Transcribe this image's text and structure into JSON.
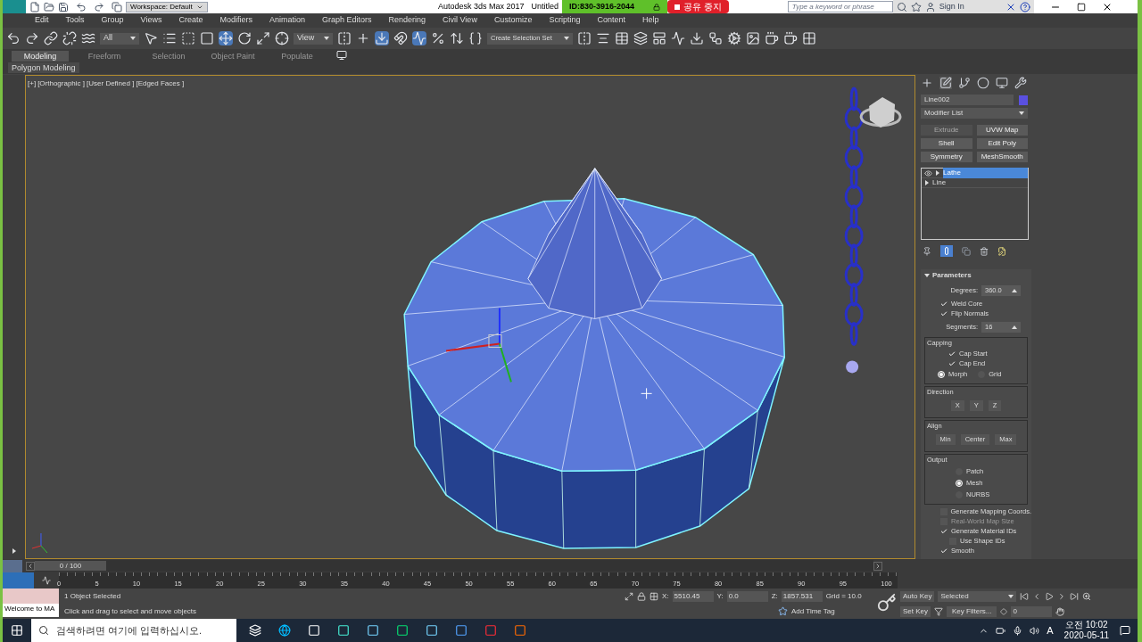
{
  "title_bar": {
    "workspace": "Workspace: Default",
    "app_title": "Autodesk 3ds Max 2017",
    "doc_title": "Untitled",
    "session_id": "ID:830-3916-2044",
    "stop_share": "공유 중지",
    "search": {
      "placeholder": "Type a keyword or phrase"
    },
    "sign_in": "Sign In"
  },
  "menu": [
    "Edit",
    "Tools",
    "Group",
    "Views",
    "Create",
    "Modifiers",
    "Animation",
    "Graph Editors",
    "Rendering",
    "Civil View",
    "Customize",
    "Scripting",
    "Content",
    "Help"
  ],
  "toolbar": {
    "selection_filter": "All",
    "reference_coord": "View",
    "named_selection": "Create Selection Set"
  },
  "ribbon_tabs": [
    {
      "label": "Modeling",
      "selected": true
    },
    {
      "label": "Freeform",
      "selected": false
    },
    {
      "label": "Selection",
      "selected": false
    },
    {
      "label": "Object Paint",
      "selected": false
    },
    {
      "label": "Populate",
      "selected": false
    }
  ],
  "ribbon_panel": "Polygon Modeling",
  "viewport": {
    "labels": [
      "[+]",
      "[Orthographic ]",
      "[User Defined ]",
      "[Edged Faces ]"
    ]
  },
  "command_panel": {
    "object_name": "Line002",
    "modifier_list": "Modifier List",
    "modifier_buttons": [
      {
        "label": "Extrude",
        "disabled": true
      },
      {
        "label": "UVW Map",
        "disabled": false
      },
      {
        "label": "Shell",
        "disabled": false
      },
      {
        "label": "Edit Poly",
        "disabled": false
      },
      {
        "label": "Symmetry",
        "disabled": false
      },
      {
        "label": "MeshSmooth",
        "disabled": false
      }
    ],
    "stack": [
      {
        "label": "Lathe",
        "selected": true
      },
      {
        "label": "Line",
        "selected": false
      }
    ],
    "rollout_title": "Parameters",
    "parameters": [
      {
        "kind": "spinner",
        "label": "Degrees:",
        "value": "360.0"
      },
      {
        "kind": "checkbox",
        "label": "Weld Core",
        "checked": true,
        "disabled": false
      },
      {
        "kind": "checkbox",
        "label": "Flip Normals",
        "checked": true,
        "disabled": false
      },
      {
        "kind": "spinner",
        "label": "Segments:",
        "value": "16"
      },
      {
        "kind": "group",
        "title": "Capping",
        "items": [
          {
            "kind": "checkbox",
            "label": "Cap Start",
            "checked": true,
            "disabled": false
          },
          {
            "kind": "checkbox",
            "label": "Cap End",
            "checked": true,
            "disabled": false
          },
          {
            "kind": "radio_row",
            "options": [
              {
                "label": "Morph",
                "selected": true
              },
              {
                "label": "Grid",
                "selected": false
              }
            ]
          }
        ]
      },
      {
        "kind": "group",
        "title": "Direction",
        "items": [
          {
            "kind": "buttons",
            "labels": [
              "X",
              "Y",
              "Z"
            ]
          }
        ]
      },
      {
        "kind": "group",
        "title": "Align",
        "items": [
          {
            "kind": "buttons",
            "labels": [
              "Min",
              "Center",
              "Max"
            ]
          }
        ]
      },
      {
        "kind": "group",
        "title": "Output",
        "items": [
          {
            "kind": "radio",
            "label": "Patch",
            "selected": false
          },
          {
            "kind": "radio",
            "label": "Mesh",
            "selected": true
          },
          {
            "kind": "radio",
            "label": "NURBS",
            "selected": false
          }
        ]
      },
      {
        "kind": "checkbox",
        "label": "Generate Mapping Coords.",
        "checked": false,
        "disabled": false
      },
      {
        "kind": "checkbox",
        "label": "Real-World Map Size",
        "checked": false,
        "disabled": true
      },
      {
        "kind": "checkbox",
        "label": "Generate Material IDs",
        "checked": true,
        "disabled": false,
        "children": [
          {
            "kind": "checkbox",
            "label": "Use Shape IDs",
            "checked": false,
            "disabled": false
          }
        ]
      },
      {
        "kind": "checkbox",
        "label": "Smooth",
        "checked": true,
        "disabled": false
      }
    ]
  },
  "timeline": {
    "frame": "0 / 100",
    "level": 0,
    "track_bar": {
      "on": true
    },
    "ticks": [
      "0",
      "5",
      "10",
      "15",
      "20",
      "25",
      "30",
      "35",
      "40",
      "45",
      "50",
      "55",
      "60",
      "65",
      "70",
      "75",
      "80",
      "85",
      "90",
      "95",
      "100"
    ]
  },
  "status": {
    "maxscript": "Welcome to MA",
    "selection": "1 Object Selected",
    "prompt": "Click and drag to select and move objects",
    "coordinates": [
      {
        "label": "X:",
        "value": "5510.45"
      },
      {
        "label": "Y:",
        "value": "0.0"
      },
      {
        "label": "Z:",
        "value": "1857.531"
      }
    ],
    "grid": "Grid = 10.0",
    "add_time_tag": "Add Time Tag",
    "auto_key": "Auto Key",
    "key_mode": "Selected",
    "set_key": "Set Key",
    "key_filters": "Key Filters...",
    "current_frame": "0"
  },
  "taskbar": {
    "search_placeholder": "검색하려면 여기에 입력하십시오.",
    "ime": "A",
    "time": "오전 10:02",
    "date": "2020-05-11"
  }
}
